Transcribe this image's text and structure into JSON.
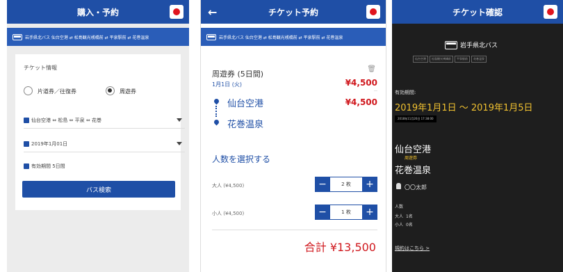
{
  "screen1": {
    "title": "購入・予約",
    "route_bar": "岩手県北バス 仙台空港 ⇄ 松島観光桟橋前 ⇄ 平泉駅前 ⇄ 花巻温泉",
    "section_label": "チケット情報",
    "radio_options": [
      "片道券／往復券",
      "周遊券"
    ],
    "selected_option": "周遊券",
    "route_field": "仙台空港 ⇔ 松島 ⇔ 平泉 ⇔ 花巻",
    "date_field": "2019年1月01日",
    "validity_field": "有効期間 5日間",
    "search_button": "バス検索"
  },
  "screen2": {
    "title": "チケット予約",
    "route_bar": "岩手県北バス 仙台空港 ⇄ 松島観光桟橋前 ⇄ 平泉駅前 ⇄ 花巻温泉",
    "ticket_name": "周遊券 (5日間)",
    "date": "1月1日 (火)",
    "price_top": "¥4,500",
    "price_mid": "¥4,500",
    "origin": "仙台空港",
    "destination": "花巻温泉",
    "select_people": "人数を選択する",
    "adult_label": "大人 (¥4,500)",
    "adult_count": "2 枚",
    "child_label": "小人 (¥4,500)",
    "child_count": "1 枚",
    "total": "合計 ¥13,500"
  },
  "screen3": {
    "title": "チケット確認",
    "company": "岩手県北バス",
    "stops": [
      "仙台空港",
      "松島観光桟橋前",
      "平泉駅前",
      "花巻温泉"
    ],
    "validity_label": "有効期間:",
    "validity": "2019年1月1日 〜 2019年1月5日",
    "timestamp": "2018年11月26日 17:38:00",
    "origin": "仙台空港",
    "ticket_type": "周遊券",
    "destination": "花巻温泉",
    "passenger": "〇〇太郎",
    "people_label": "人数",
    "adult_label": "大人",
    "adult_count": "1名",
    "child_label": "小人",
    "child_count": "0名",
    "terms_link": "規約はこちら >"
  },
  "colors": {
    "brand": "#1f4fa6",
    "price": "#d0181e",
    "highlight": "#f2c230"
  }
}
